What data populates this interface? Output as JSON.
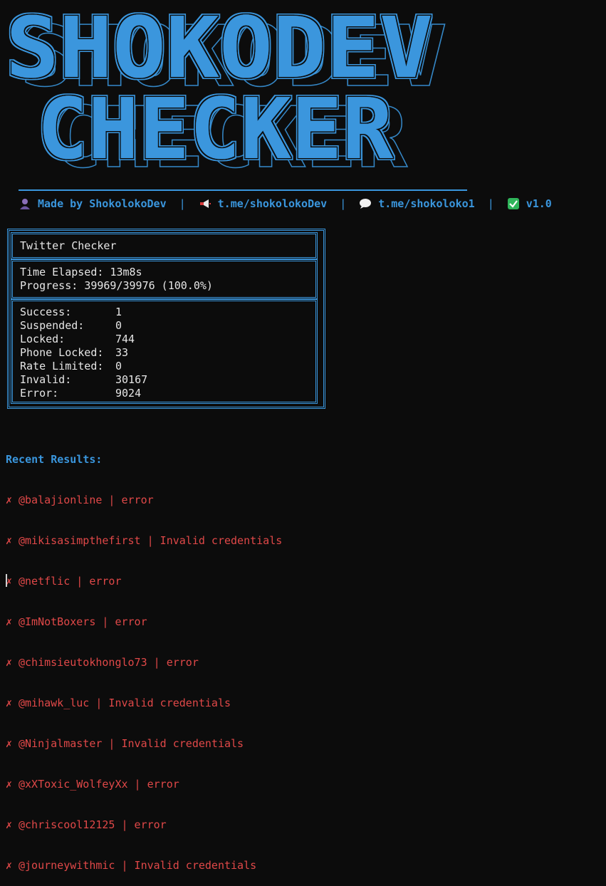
{
  "banner": {
    "line1": "SHOKODEV",
    "line2": "CHECKER"
  },
  "info": {
    "made_by": "Made by ShokolokoDev",
    "channel": "t.me/shokolokoDev",
    "chat": "t.me/shokoloko1",
    "version": "v1.0",
    "separator": "|"
  },
  "panel": {
    "title": "Twitter Checker",
    "time_label": "Time Elapsed:",
    "time_value": "13m8s",
    "progress_label": "Progress:",
    "progress_value": "39969/39976 (100.0%)",
    "stats": [
      {
        "label": "Success:",
        "value": "1"
      },
      {
        "label": "Suspended:",
        "value": "0"
      },
      {
        "label": "Locked:",
        "value": "744"
      },
      {
        "label": "Phone Locked:",
        "value": "33"
      },
      {
        "label": "Rate Limited:",
        "value": "0"
      },
      {
        "label": "Invalid:",
        "value": "30167"
      },
      {
        "label": "Error:",
        "value": "9024"
      }
    ]
  },
  "recent": {
    "heading": "Recent Results:",
    "mark": "✗",
    "items": [
      "@balajionline | error",
      "@mikisasimpthefirst | Invalid credentials",
      "@netflic | error",
      "@ImNotBoxers | error",
      "@chimsieutokhonglo73 | error",
      "@mihawk_luc | Invalid credentials",
      "@Ninjalmaster | Invalid credentials",
      "@xXToxic_WolfeyXx | error",
      "@chriscool12125 | error",
      "@journeywithmic | Invalid credentials"
    ]
  },
  "colors": {
    "accent": "#3a96dd",
    "error": "#e04848",
    "background": "#0c0c0c"
  }
}
